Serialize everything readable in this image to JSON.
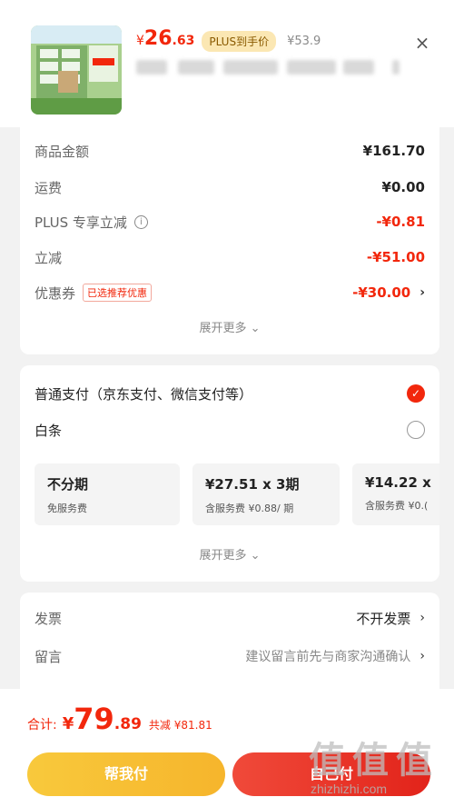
{
  "product": {
    "price_symbol": "¥",
    "price_int": "26",
    "price_dec": ".63",
    "plus_badge": "PLUS到手价",
    "original_price": "¥53.9",
    "close": "×"
  },
  "summary": {
    "rows": [
      {
        "label": "商品金额",
        "value": "¥161.70"
      },
      {
        "label": "运费",
        "value": "¥0.00"
      },
      {
        "label": "PLUS 专享立减",
        "value": "-¥0.81"
      },
      {
        "label": "立减",
        "value": "-¥51.00"
      },
      {
        "label": "优惠券",
        "tag": "已选推荐优惠",
        "value": "-¥30.00",
        "chevron": "›"
      }
    ],
    "info_icon": "i",
    "more": "展开更多 ⌄"
  },
  "payment": {
    "normal": "普通支付（京东支付、微信支付等）",
    "normal_check": "✓",
    "baitiao": "白条",
    "options": [
      {
        "title": "不分期",
        "sub": "免服务费"
      },
      {
        "title": "¥27.51 x 3期",
        "sub": "含服务费 ¥0.88/ 期"
      },
      {
        "title": "¥14.22 x",
        "sub": "含服务费 ¥0.("
      }
    ],
    "more": "展开更多 ⌄"
  },
  "invoice": {
    "label": "发票",
    "value": "不开发票",
    "chevron": "›",
    "message_label": "留言",
    "message_placeholder": "建议留言前先与商家沟通确认",
    "message_chevron": "›"
  },
  "footer": {
    "total_label": "合计:",
    "total_symbol": "¥",
    "total_int": "79",
    "total_dec": ".89",
    "saved": "共减 ¥81.81",
    "help_pay": "帮我付",
    "self_pay": "自己付"
  },
  "watermark": {
    "chars": [
      "值",
      "值",
      "值"
    ],
    "url": "zhizhizhi.com"
  },
  "colors": {
    "accent_red": "#f2270c",
    "plus_badge_bg": "#fbe7b3",
    "help_button": "#f8c93c"
  }
}
